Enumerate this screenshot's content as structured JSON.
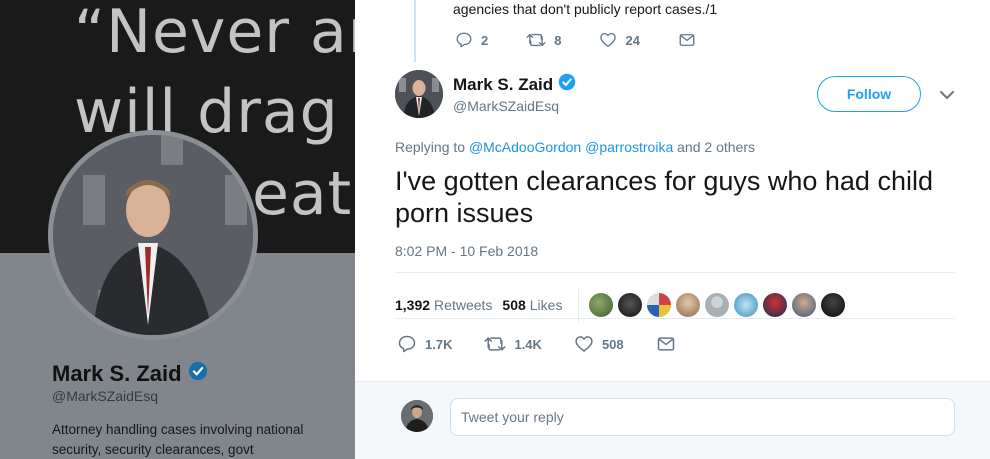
{
  "background": {
    "banner_lines": [
      "“Never arg",
      "will drag y",
      "eat"
    ],
    "profile": {
      "name": "Mark S. Zaid",
      "handle": "@MarkSZaidEsq",
      "bio": "Attorney handling cases involving national security, security clearances, govt"
    }
  },
  "previous_tweet": {
    "text": "agencies that don't publicly report cases./1",
    "replies": "2",
    "retweets": "8",
    "likes": "24"
  },
  "tweet": {
    "author_name": "Mark S. Zaid",
    "author_handle": "@MarkSZaidEsq",
    "follow_label": "Follow",
    "replying_prefix": "Replying to",
    "mention_1": "@McAdooGordon",
    "mention_2": "@parrostroika",
    "replying_suffix": "and 2 others",
    "text": "I've gotten clearances for guys who had child porn issues",
    "timestamp": "8:02 PM - 10 Feb 2018",
    "retweets_count": "1,392",
    "retweets_label": "Retweets",
    "likes_count": "508",
    "likes_label": "Likes",
    "replies": "1.7K",
    "retweets": "1.4K",
    "likes": "508"
  },
  "reply_box": {
    "placeholder": "Tweet your reply"
  },
  "colors": {
    "accent": "#1da1f2",
    "verified": "#1da1f2",
    "text_secondary": "#657786"
  },
  "icons": [
    "reply-icon",
    "retweet-icon",
    "like-icon",
    "message-icon",
    "verified-badge-icon",
    "chevron-down-icon"
  ]
}
